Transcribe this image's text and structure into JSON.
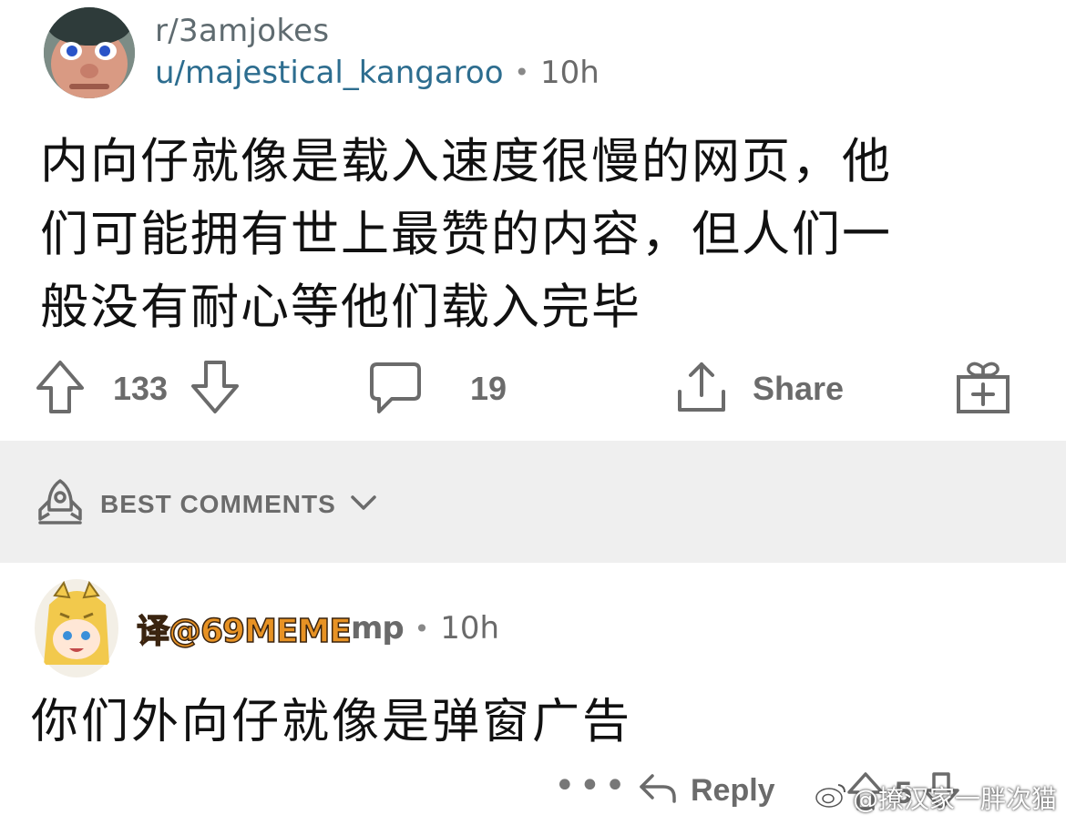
{
  "post": {
    "subreddit": "r/3amjokes",
    "author": "u/majestical_kangaroo",
    "separator": "•",
    "time": "10h",
    "body_lines": [
      "内向仔就像是载入速度很慢的网页，他",
      "们可能拥有世上最赞的内容，但人们一",
      "般没有耐心等他们载入完毕"
    ],
    "upvotes": "133",
    "comments": "19",
    "share_label": "Share"
  },
  "sort": {
    "label": "BEST COMMENTS"
  },
  "comment": {
    "watermark": "译@69MEME",
    "author_suffix": "mp",
    "separator": "•",
    "time": "10h",
    "body": "你们外向仔就像是弹窗广告",
    "more": "•••",
    "reply_label": "Reply",
    "score": "5"
  },
  "weibo_watermark": {
    "text": "@撩汉家一胖次猫"
  },
  "colors": {
    "author_link": "#2d6d8f",
    "muted_text": "#6b6b6b",
    "band_bg": "#efefef",
    "watermark_fill": "#e79224"
  }
}
